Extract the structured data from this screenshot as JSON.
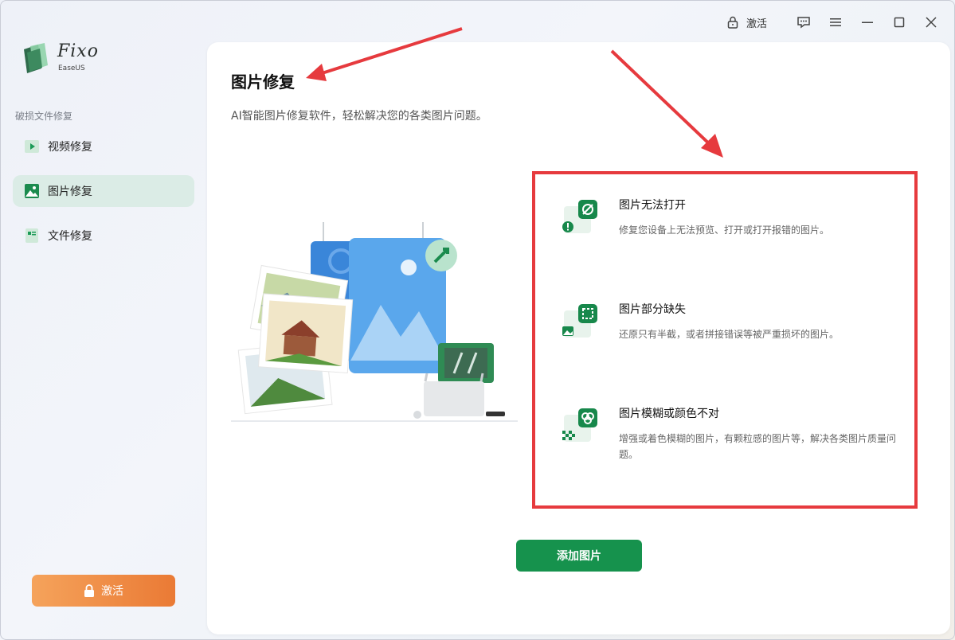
{
  "app": {
    "name": "Fixo",
    "sub": "EaseUS"
  },
  "sidebar": {
    "section_label": "破损文件修复",
    "items": [
      {
        "label": "视频修复",
        "icon": "video-play-icon"
      },
      {
        "label": "图片修复",
        "icon": "image-icon",
        "active": true
      },
      {
        "label": "文件修复",
        "icon": "document-icon"
      }
    ],
    "activate_label": "激活"
  },
  "topbar": {
    "activate_label": "激活",
    "icons": [
      "lock-icon",
      "feedback-icon",
      "menu-icon",
      "minimize-icon",
      "maximize-icon",
      "close-icon"
    ]
  },
  "main": {
    "title": "图片修复",
    "subtitle": "AI智能图片修复软件，轻松解决您的各类图片问题。",
    "features": [
      {
        "title": "图片无法打开",
        "desc": "修复您设备上无法预览、打开或打开报错的图片。",
        "icon": "image-cannot-open-icon"
      },
      {
        "title": "图片部分缺失",
        "desc": "还原只有半截，或者拼接错误等被严重损坏的图片。",
        "icon": "image-partial-missing-icon"
      },
      {
        "title": "图片模糊或颜色不对",
        "desc": "增强或着色模糊的图片，有颗粒感的图片等，解决各类图片质量问题。",
        "icon": "image-blurry-icon"
      }
    ],
    "add_button": "添加图片"
  },
  "colors": {
    "accent": "#16924d",
    "highlight_box": "#e63a3e",
    "activate": "#ea7a35"
  }
}
